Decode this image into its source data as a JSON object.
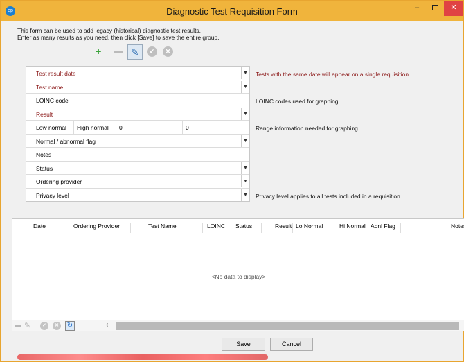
{
  "window": {
    "title": "Diagnostic Test Requisition Form",
    "app_icon": "app-logo-icon"
  },
  "intro": {
    "line1": "This form can be used to add legacy (historical) diagnostic test results.",
    "line2": "Enter as many results as you need, then click [Save] to save the entire group."
  },
  "toolbar": {
    "add": "+",
    "edit": "✎",
    "check": "✓",
    "cancel": "✕"
  },
  "form": {
    "rows": [
      {
        "label": "Test result date",
        "required": true,
        "dropdown": true,
        "hint": "Tests with the same date will appear on a single requisition"
      },
      {
        "label": "Test name",
        "required": true,
        "dropdown": true,
        "hint": ""
      },
      {
        "label": "LOINC code",
        "required": false,
        "dropdown": false,
        "hint": "LOINC codes used for graphing"
      },
      {
        "label": "Result",
        "required": true,
        "dropdown": true,
        "hint": ""
      },
      {
        "label": "Low normal",
        "label2": "High normal",
        "low_value": "0",
        "high_value": "0",
        "hint": "Range information needed for graphing"
      },
      {
        "label": "Normal / abnormal flag",
        "required": false,
        "dropdown": true,
        "hint": ""
      },
      {
        "label": "Notes",
        "required": false,
        "dropdown": false,
        "hint": ""
      },
      {
        "label": "Status",
        "required": false,
        "dropdown": true,
        "hint": ""
      },
      {
        "label": "Ordering provider",
        "required": false,
        "dropdown": true,
        "hint": ""
      },
      {
        "label": "Privacy level",
        "required": false,
        "dropdown": true,
        "hint": "Privacy level applies to all tests included in a requisition"
      }
    ]
  },
  "grid": {
    "columns": [
      "Date",
      "Ordering Provider",
      "Test Name",
      "LOINC",
      "Status",
      "Result",
      "Lo Normal",
      "Hi Normal",
      "Abnl Flag",
      "Notes"
    ],
    "empty_text": "<No data to display>"
  },
  "footer": {
    "save_label": "Save",
    "cancel_label": "Cancel",
    "scroll_left": "‹"
  },
  "colors": {
    "titlebar": "#f0b43c",
    "required_label": "#8c1a1a",
    "close_button": "#e04343"
  }
}
